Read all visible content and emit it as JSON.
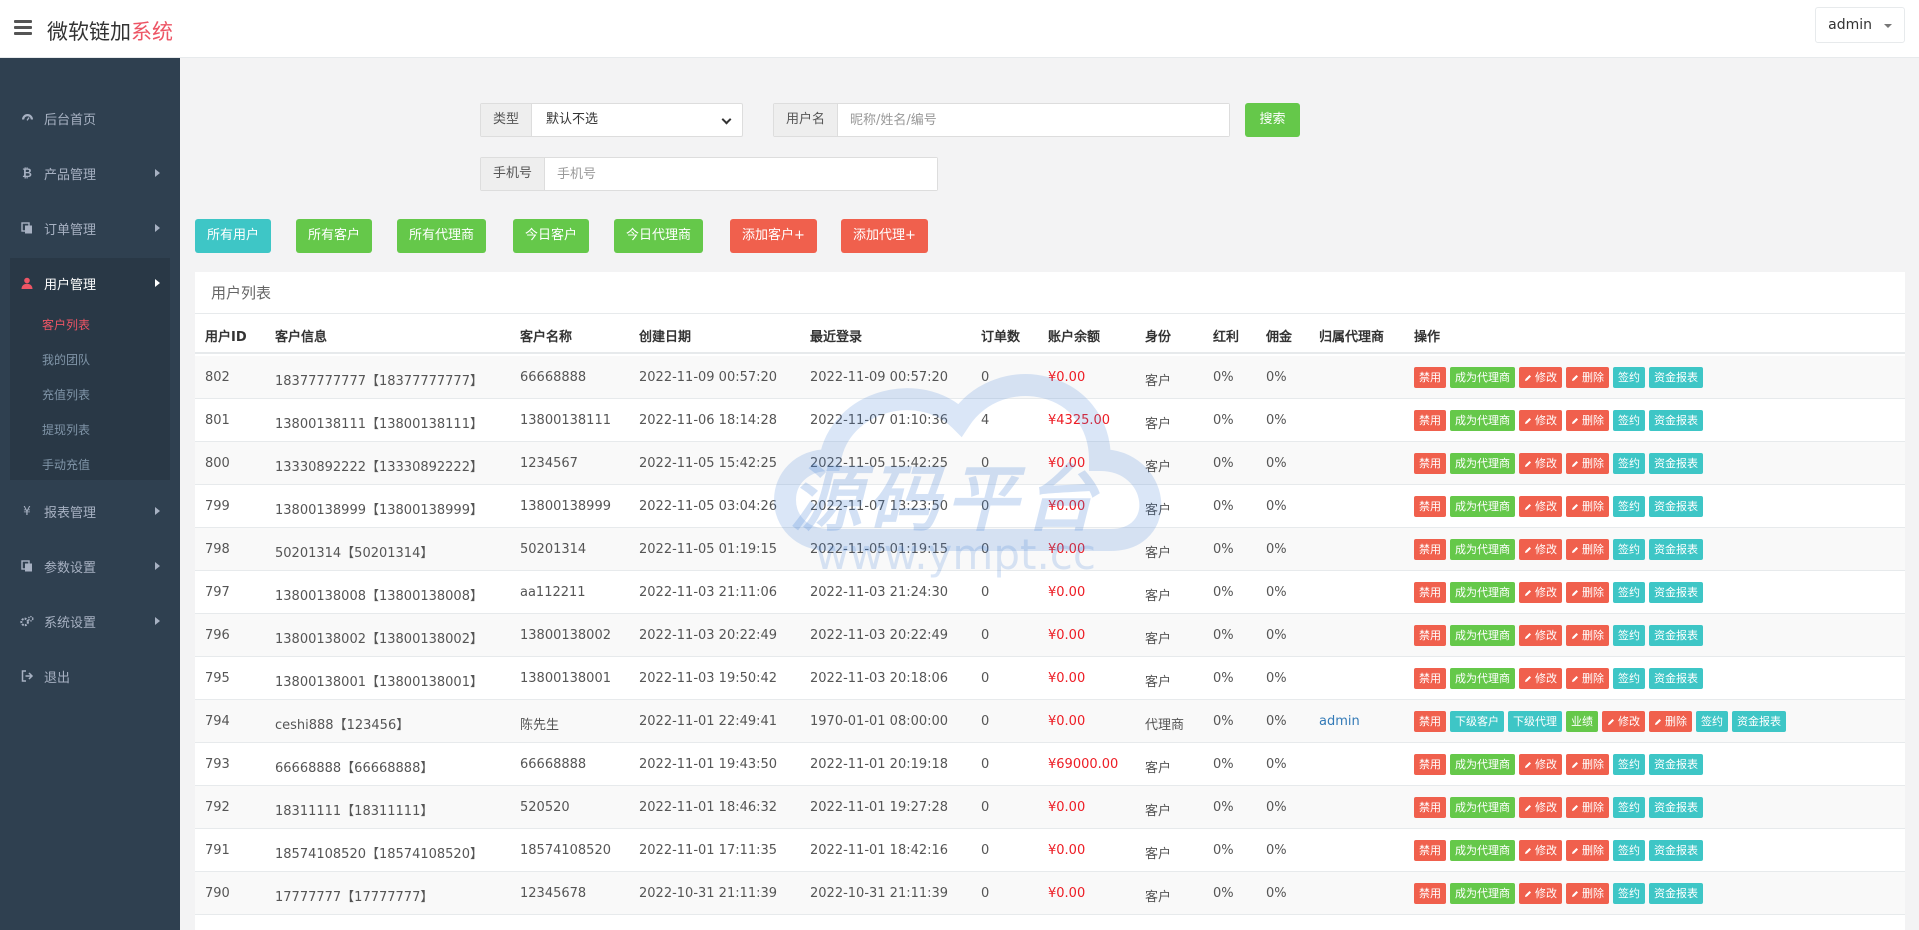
{
  "header": {
    "brand_main": "微软链加",
    "brand_highlight": "系统",
    "user": "admin"
  },
  "sidebar": {
    "items": [
      {
        "label": "后台首页",
        "icon": "dashboard-icon"
      },
      {
        "label": "产品管理",
        "icon": "bitcoin-icon"
      },
      {
        "label": "订单管理",
        "icon": "copy-icon"
      },
      {
        "label": "用户管理",
        "icon": "user-icon"
      },
      {
        "label": "报表管理",
        "icon": "yen-icon"
      },
      {
        "label": "参数设置",
        "icon": "copy-icon"
      },
      {
        "label": "系统设置",
        "icon": "gears-icon"
      },
      {
        "label": "退出",
        "icon": "sign-out-icon"
      }
    ],
    "sub_items": [
      "客户列表",
      "我的团队",
      "充值列表",
      "提现列表",
      "手动充值"
    ]
  },
  "search": {
    "type_label": "类型",
    "type_value": "默认不选",
    "username_label": "用户名",
    "username_placeholder": "昵称/姓名/编号",
    "search_button": "搜索",
    "phone_label": "手机号",
    "phone_placeholder": "手机号"
  },
  "filters": [
    "所有用户",
    "所有客户",
    "所有代理商",
    "今日客户",
    "今日代理商",
    "添加客户+",
    "添加代理+"
  ],
  "table": {
    "title": "用户列表",
    "columns": [
      "用户ID",
      "客户信息",
      "客户名称",
      "创建日期",
      "最近登录",
      "订单数",
      "账户余额",
      "身份",
      "红利",
      "佣金",
      "归属代理商",
      "操作"
    ],
    "rows": [
      {
        "id": "802",
        "info": "18377777777【18377777777】",
        "name": "66668888",
        "created": "2022-11-09 00:57:20",
        "login": "2022-11-09 00:57:20",
        "orders": "0",
        "balance": "¥0.00",
        "role": "客户",
        "bonus": "0%",
        "commission": "0%",
        "agent": ""
      },
      {
        "id": "801",
        "info": "13800138111【13800138111】",
        "name": "13800138111",
        "created": "2022-11-06 18:14:28",
        "login": "2022-11-07 01:10:36",
        "orders": "4",
        "balance": "¥4325.00",
        "role": "客户",
        "bonus": "0%",
        "commission": "0%",
        "agent": ""
      },
      {
        "id": "800",
        "info": "13330892222【13330892222】",
        "name": "1234567",
        "created": "2022-11-05 15:42:25",
        "login": "2022-11-05 15:42:25",
        "orders": "0",
        "balance": "¥0.00",
        "role": "客户",
        "bonus": "0%",
        "commission": "0%",
        "agent": ""
      },
      {
        "id": "799",
        "info": "13800138999【13800138999】",
        "name": "13800138999",
        "created": "2022-11-05 03:04:26",
        "login": "2022-11-07 13:23:50",
        "orders": "0",
        "balance": "¥0.00",
        "role": "客户",
        "bonus": "0%",
        "commission": "0%",
        "agent": ""
      },
      {
        "id": "798",
        "info": "50201314【50201314】",
        "name": "50201314",
        "created": "2022-11-05 01:19:15",
        "login": "2022-11-05 01:19:15",
        "orders": "0",
        "balance": "¥0.00",
        "role": "客户",
        "bonus": "0%",
        "commission": "0%",
        "agent": ""
      },
      {
        "id": "797",
        "info": "13800138008【13800138008】",
        "name": "aa112211",
        "created": "2022-11-03 21:11:06",
        "login": "2022-11-03 21:24:30",
        "orders": "0",
        "balance": "¥0.00",
        "role": "客户",
        "bonus": "0%",
        "commission": "0%",
        "agent": ""
      },
      {
        "id": "796",
        "info": "13800138002【13800138002】",
        "name": "13800138002",
        "created": "2022-11-03 20:22:49",
        "login": "2022-11-03 20:22:49",
        "orders": "0",
        "balance": "¥0.00",
        "role": "客户",
        "bonus": "0%",
        "commission": "0%",
        "agent": ""
      },
      {
        "id": "795",
        "info": "13800138001【13800138001】",
        "name": "13800138001",
        "created": "2022-11-03 19:50:42",
        "login": "2022-11-03 20:18:06",
        "orders": "0",
        "balance": "¥0.00",
        "role": "客户",
        "bonus": "0%",
        "commission": "0%",
        "agent": ""
      },
      {
        "id": "794",
        "info": "ceshi888【123456】",
        "name": "陈先生",
        "created": "2022-11-01 22:49:41",
        "login": "1970-01-01 08:00:00",
        "orders": "0",
        "balance": "¥0.00",
        "role": "代理商",
        "bonus": "0%",
        "commission": "0%",
        "agent": "admin"
      },
      {
        "id": "793",
        "info": "66668888【66668888】",
        "name": "66668888",
        "created": "2022-11-01 19:43:50",
        "login": "2022-11-01 20:19:18",
        "orders": "0",
        "balance": "¥69000.00",
        "role": "客户",
        "bonus": "0%",
        "commission": "0%",
        "agent": ""
      },
      {
        "id": "792",
        "info": "18311111【18311111】",
        "name": "520520",
        "created": "2022-11-01 18:46:32",
        "login": "2022-11-01 19:27:28",
        "orders": "0",
        "balance": "¥0.00",
        "role": "客户",
        "bonus": "0%",
        "commission": "0%",
        "agent": ""
      },
      {
        "id": "791",
        "info": "18574108520【18574108520】",
        "name": "18574108520",
        "created": "2022-11-01 17:11:35",
        "login": "2022-11-01 18:42:16",
        "orders": "0",
        "balance": "¥0.00",
        "role": "客户",
        "bonus": "0%",
        "commission": "0%",
        "agent": ""
      },
      {
        "id": "790",
        "info": "17777777【17777777】",
        "name": "12345678",
        "created": "2022-10-31 21:11:39",
        "login": "2022-10-31 21:11:39",
        "orders": "0",
        "balance": "¥0.00",
        "role": "客户",
        "bonus": "0%",
        "commission": "0%",
        "agent": ""
      }
    ],
    "customer_ops": [
      {
        "label": "禁用",
        "color": "#f0604d"
      },
      {
        "label": "成为代理商",
        "color": "#65c84a"
      },
      {
        "label": "修改",
        "color": "#f0604d",
        "icon": "pencil-icon"
      },
      {
        "label": "删除",
        "color": "#f0604d",
        "icon": "pencil-icon"
      },
      {
        "label": "签约",
        "color": "#3ec6c6"
      },
      {
        "label": "资金报表",
        "color": "#3ec6c6"
      }
    ],
    "agent_ops": [
      {
        "label": "禁用",
        "color": "#f0604d"
      },
      {
        "label": "下级客户",
        "color": "#3ec6c6"
      },
      {
        "label": "下级代理",
        "color": "#3ec6c6"
      },
      {
        "label": "业绩",
        "color": "#65c84a"
      },
      {
        "label": "修改",
        "color": "#f0604d",
        "icon": "pencil-icon"
      },
      {
        "label": "删除",
        "color": "#f0604d",
        "icon": "pencil-icon"
      },
      {
        "label": "签约",
        "color": "#3ec6c6"
      },
      {
        "label": "资金报表",
        "color": "#3ec6c6"
      }
    ]
  },
  "watermark": {
    "text": "源码平台",
    "url": "www.ympt.cc"
  }
}
